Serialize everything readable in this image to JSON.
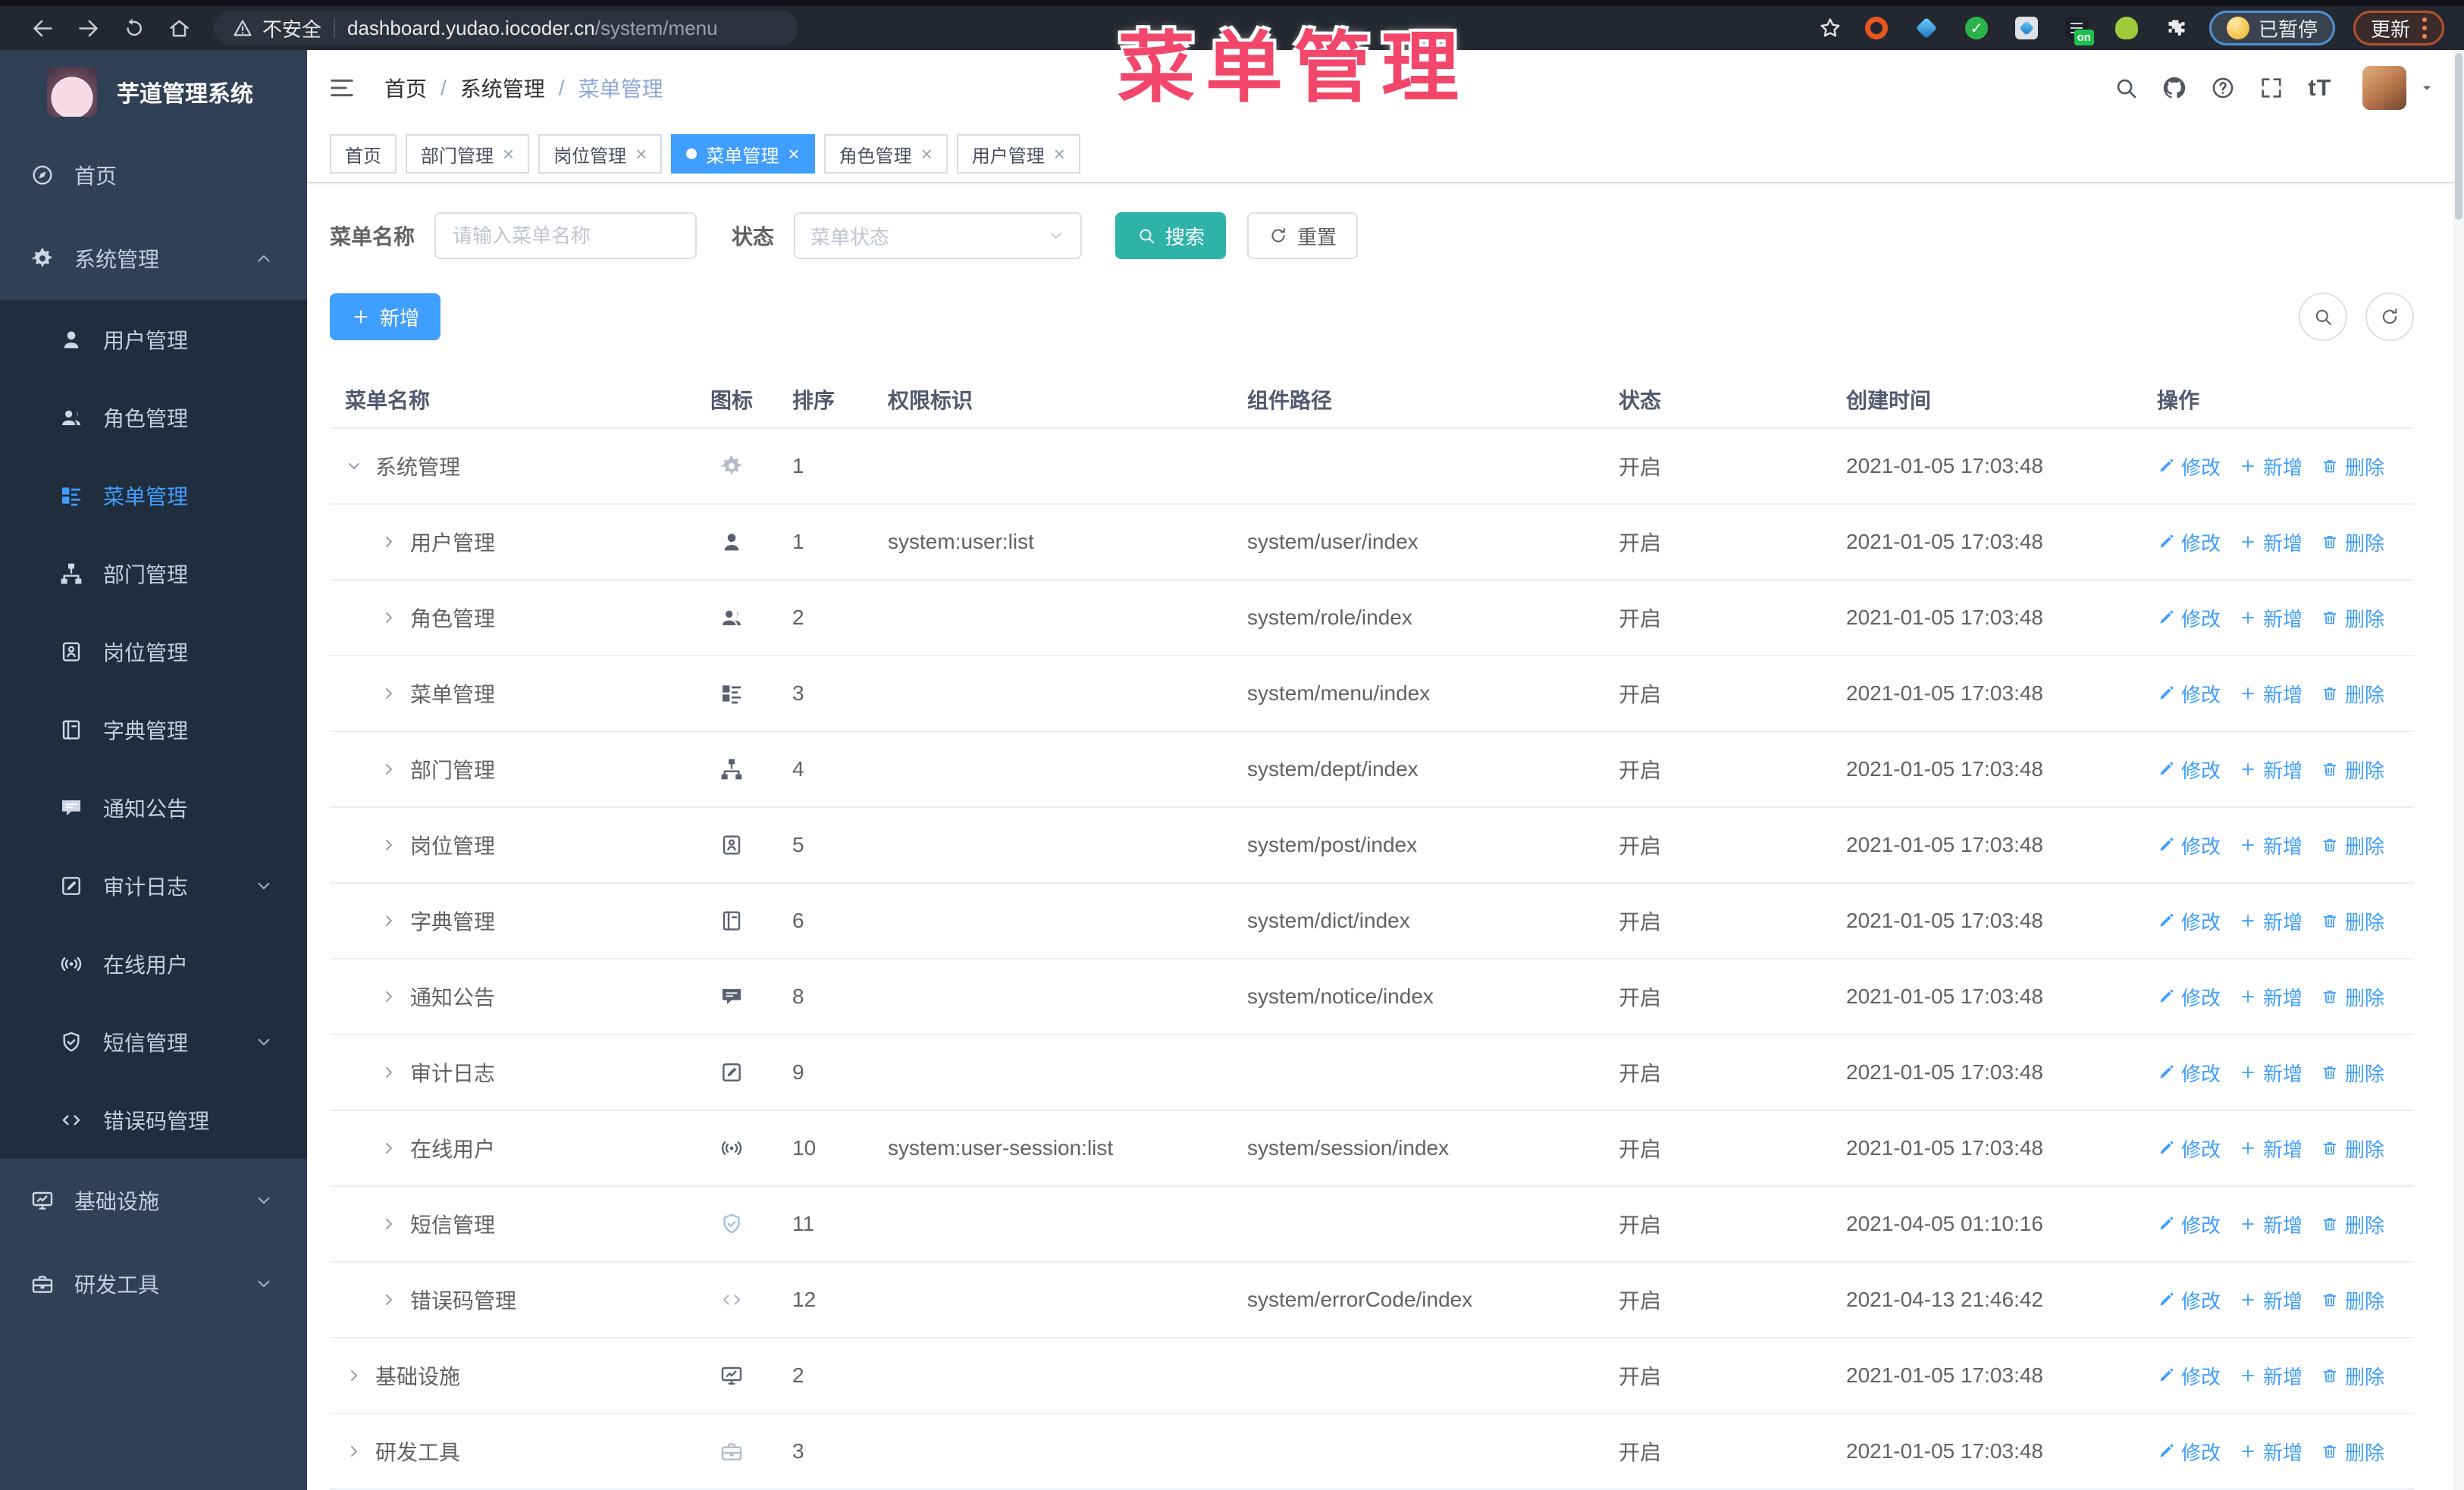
{
  "overlay_title": "菜单管理",
  "browser": {
    "security_label": "不安全",
    "url_host": "dashboard.yudao.iocoder.cn",
    "url_path": "/system/menu",
    "ext_on_badge": "on",
    "paused_label": "已暂停",
    "update_label": "更新"
  },
  "sidebar": {
    "app_title": "芋道管理系统",
    "items": [
      {
        "label": "首页",
        "icon": "home",
        "type": "top"
      },
      {
        "label": "系统管理",
        "icon": "gear",
        "type": "top",
        "chevron": "up"
      },
      {
        "label": "用户管理",
        "icon": "user",
        "type": "sub"
      },
      {
        "label": "角色管理",
        "icon": "users",
        "type": "sub"
      },
      {
        "label": "菜单管理",
        "icon": "menu",
        "type": "sub",
        "active": true
      },
      {
        "label": "部门管理",
        "icon": "tree",
        "type": "sub"
      },
      {
        "label": "岗位管理",
        "icon": "post",
        "type": "sub"
      },
      {
        "label": "字典管理",
        "icon": "book",
        "type": "sub"
      },
      {
        "label": "通知公告",
        "icon": "notice",
        "type": "sub"
      },
      {
        "label": "审计日志",
        "icon": "editdoc",
        "type": "sub",
        "chevron": "down"
      },
      {
        "label": "在线用户",
        "icon": "online",
        "type": "sub"
      },
      {
        "label": "短信管理",
        "icon": "shield",
        "type": "sub",
        "chevron": "down"
      },
      {
        "label": "错误码管理",
        "icon": "code",
        "type": "sub"
      },
      {
        "label": "基础设施",
        "icon": "monitor",
        "type": "top",
        "chevron": "down"
      },
      {
        "label": "研发工具",
        "icon": "tool",
        "type": "top",
        "chevron": "down"
      }
    ]
  },
  "header": {
    "breadcrumb": [
      "首页",
      "系统管理",
      "菜单管理"
    ],
    "font_size_icon": "tT"
  },
  "tabs": [
    {
      "label": "首页",
      "closable": false,
      "active": false
    },
    {
      "label": "部门管理",
      "closable": true,
      "active": false
    },
    {
      "label": "岗位管理",
      "closable": true,
      "active": false
    },
    {
      "label": "菜单管理",
      "closable": true,
      "active": true
    },
    {
      "label": "角色管理",
      "closable": true,
      "active": false
    },
    {
      "label": "用户管理",
      "closable": true,
      "active": false
    }
  ],
  "filters": {
    "name_label": "菜单名称",
    "name_placeholder": "请输入菜单名称",
    "name_value": "",
    "status_label": "状态",
    "status_placeholder": "菜单状态",
    "search_label": "搜索",
    "reset_label": "重置"
  },
  "toolbar": {
    "add_label": "新增"
  },
  "actions": {
    "edit": "修改",
    "add": "新增",
    "delete": "删除"
  },
  "table": {
    "headers": [
      "菜单名称",
      "图标",
      "排序",
      "权限标识",
      "组件路径",
      "状态",
      "创建时间",
      "操作"
    ],
    "rows": [
      {
        "name": "系统管理",
        "icon": "gear",
        "icon_style": "muted",
        "level": 0,
        "caret": "down",
        "sort": "1",
        "perm": "",
        "path": "",
        "status": "开启",
        "time": "2021-01-05 17:03:48"
      },
      {
        "name": "用户管理",
        "icon": "user",
        "icon_style": "",
        "level": 1,
        "caret": "right",
        "sort": "1",
        "perm": "system:user:list",
        "path": "system/user/index",
        "status": "开启",
        "time": "2021-01-05 17:03:48"
      },
      {
        "name": "角色管理",
        "icon": "users",
        "icon_style": "",
        "level": 1,
        "caret": "right",
        "sort": "2",
        "perm": "",
        "path": "system/role/index",
        "status": "开启",
        "time": "2021-01-05 17:03:48"
      },
      {
        "name": "菜单管理",
        "icon": "menu",
        "icon_style": "",
        "level": 1,
        "caret": "right",
        "sort": "3",
        "perm": "",
        "path": "system/menu/index",
        "status": "开启",
        "time": "2021-01-05 17:03:48"
      },
      {
        "name": "部门管理",
        "icon": "tree",
        "icon_style": "",
        "level": 1,
        "caret": "right",
        "sort": "4",
        "perm": "",
        "path": "system/dept/index",
        "status": "开启",
        "time": "2021-01-05 17:03:48"
      },
      {
        "name": "岗位管理",
        "icon": "post",
        "icon_style": "",
        "level": 1,
        "caret": "right",
        "sort": "5",
        "perm": "",
        "path": "system/post/index",
        "status": "开启",
        "time": "2021-01-05 17:03:48"
      },
      {
        "name": "字典管理",
        "icon": "book",
        "icon_style": "",
        "level": 1,
        "caret": "right",
        "sort": "6",
        "perm": "",
        "path": "system/dict/index",
        "status": "开启",
        "time": "2021-01-05 17:03:48"
      },
      {
        "name": "通知公告",
        "icon": "notice",
        "icon_style": "",
        "level": 1,
        "caret": "right",
        "sort": "8",
        "perm": "",
        "path": "system/notice/index",
        "status": "开启",
        "time": "2021-01-05 17:03:48"
      },
      {
        "name": "审计日志",
        "icon": "editdoc",
        "icon_style": "",
        "level": 1,
        "caret": "right",
        "sort": "9",
        "perm": "",
        "path": "",
        "status": "开启",
        "time": "2021-01-05 17:03:48"
      },
      {
        "name": "在线用户",
        "icon": "online",
        "icon_style": "",
        "level": 1,
        "caret": "right",
        "sort": "10",
        "perm": "system:user-session:list",
        "path": "system/session/index",
        "status": "开启",
        "time": "2021-01-05 17:03:48"
      },
      {
        "name": "短信管理",
        "icon": "shield",
        "icon_style": "blue",
        "level": 1,
        "caret": "right",
        "sort": "11",
        "perm": "",
        "path": "",
        "status": "开启",
        "time": "2021-04-05 01:10:16"
      },
      {
        "name": "错误码管理",
        "icon": "code",
        "icon_style": "muted",
        "level": 1,
        "caret": "right",
        "sort": "12",
        "perm": "",
        "path": "system/errorCode/index",
        "status": "开启",
        "time": "2021-04-13 21:46:42"
      },
      {
        "name": "基础设施",
        "icon": "monitor",
        "icon_style": "",
        "level": 0,
        "caret": "right",
        "sort": "2",
        "perm": "",
        "path": "",
        "status": "开启",
        "time": "2021-01-05 17:03:48"
      },
      {
        "name": "研发工具",
        "icon": "tool",
        "icon_style": "muted",
        "level": 0,
        "caret": "right",
        "sort": "3",
        "perm": "",
        "path": "",
        "status": "开启",
        "time": "2021-01-05 17:03:48"
      }
    ]
  },
  "colors": {
    "primary": "#409eff",
    "search_teal": "#2fb3a9",
    "overlay_pink": "#f2476a",
    "sidebar_bg": "#304156",
    "submenu_bg": "#1f2d3d",
    "chrome_bg": "#23272f"
  }
}
